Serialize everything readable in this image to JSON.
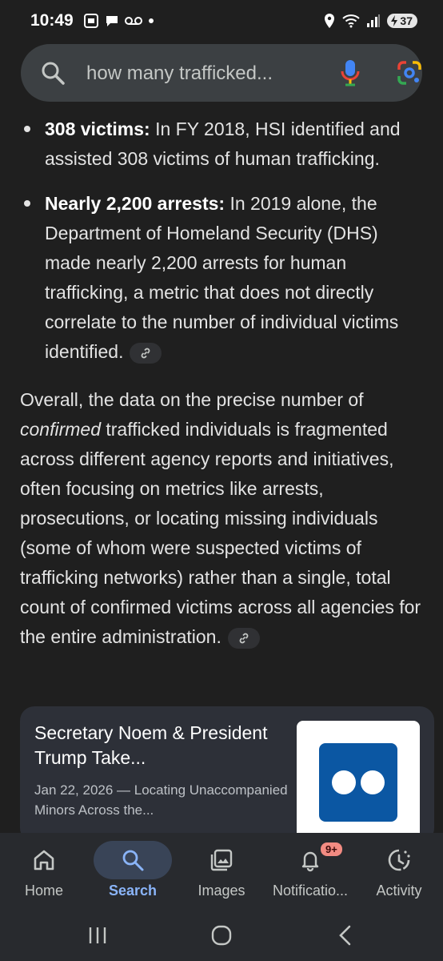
{
  "status": {
    "time": "10:49",
    "battery": "37",
    "left_icons": [
      "screenshot-icon",
      "chat-bubble-icon",
      "voicemail-icon",
      "dot-icon"
    ],
    "right_icons": [
      "location-icon",
      "wifi-icon",
      "signal-icon",
      "battery-icon"
    ]
  },
  "search": {
    "query": "how many trafficked..."
  },
  "bullets": [
    {
      "bold": "308 victims:",
      "text": " In FY 2018, HSI identified and assisted 308 victims of human trafficking."
    },
    {
      "bold": "Nearly 2,200 arrests:",
      "text": " In 2019 alone, the Department of Homeland Security (DHS) made nearly 2,200 arrests for human trafficking, a metric that does not directly correlate to the number of individual victims identified."
    }
  ],
  "summary": {
    "lead": "Overall, the data on the precise number of ",
    "emphasis": "confirmed",
    "rest": " trafficked individuals is fragmented across different agency reports and initiatives, often focusing on metrics like arrests, prosecutions, or locating missing individuals (some of whom were suspected victims of trafficking networks) rather than a single, total count of confirmed victims across all agencies for the entire administration."
  },
  "card": {
    "title": "Secretary Noem & President Trump Take...",
    "snippet": "Jan 22, 2026 — Locating Unaccompanied Minors Across the..."
  },
  "nav": {
    "items": [
      {
        "label": "Home",
        "icon": "home-icon"
      },
      {
        "label": "Search",
        "icon": "search-icon",
        "active": true
      },
      {
        "label": "Images",
        "icon": "images-icon"
      },
      {
        "label": "Notificatio...",
        "icon": "bell-icon",
        "badge": "9+"
      },
      {
        "label": "Activity",
        "icon": "activity-icon"
      }
    ]
  },
  "colors": {
    "background": "#1f1f1f",
    "accent": "#8ab4f8",
    "badge": "#f28b82"
  }
}
